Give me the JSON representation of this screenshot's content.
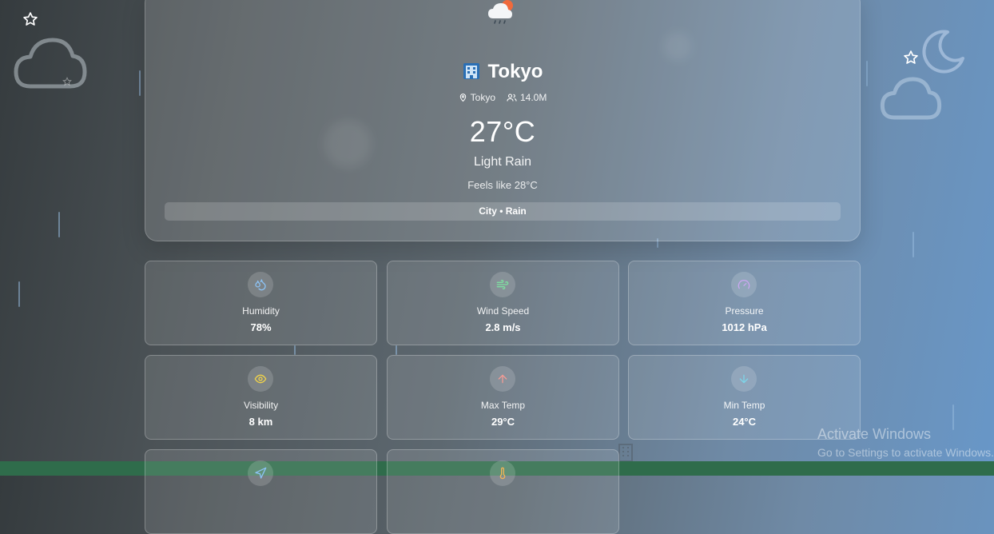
{
  "city": {
    "name": "Tokyo",
    "location": "Tokyo",
    "population": "14.0M",
    "temperature": "27°C",
    "condition": "Light Rain",
    "feels_like": "Feels like 28°C",
    "tag": "City • Rain",
    "weather_icon": "cloud-rain-sun-icon",
    "flag_icon": "city-building-icon"
  },
  "stats": [
    {
      "label": "Humidity",
      "value": "78%",
      "icon": "droplets-icon",
      "color": "#8cc3f5"
    },
    {
      "label": "Wind Speed",
      "value": "2.8 m/s",
      "icon": "wind-icon",
      "color": "#7ee0a0"
    },
    {
      "label": "Pressure",
      "value": "1012 hPa",
      "icon": "gauge-icon",
      "color": "#c9a6f0"
    },
    {
      "label": "Visibility",
      "value": "8 km",
      "icon": "eye-icon",
      "color": "#f1d34a"
    },
    {
      "label": "Max Temp",
      "value": "29°C",
      "icon": "arrow-up-icon",
      "color": "#f19b95"
    },
    {
      "label": "Min Temp",
      "value": "24°C",
      "icon": "arrow-down-icon",
      "color": "#7ed3e8"
    },
    {
      "label": "",
      "value": "",
      "icon": "navigation-icon",
      "color": "#8cc3f5"
    },
    {
      "label": "",
      "value": "",
      "icon": "thermometer-icon",
      "color": "#f3b458"
    }
  ],
  "watermark": {
    "line1": "Activate Windows",
    "line2": "Go to Settings to activate Windows."
  }
}
